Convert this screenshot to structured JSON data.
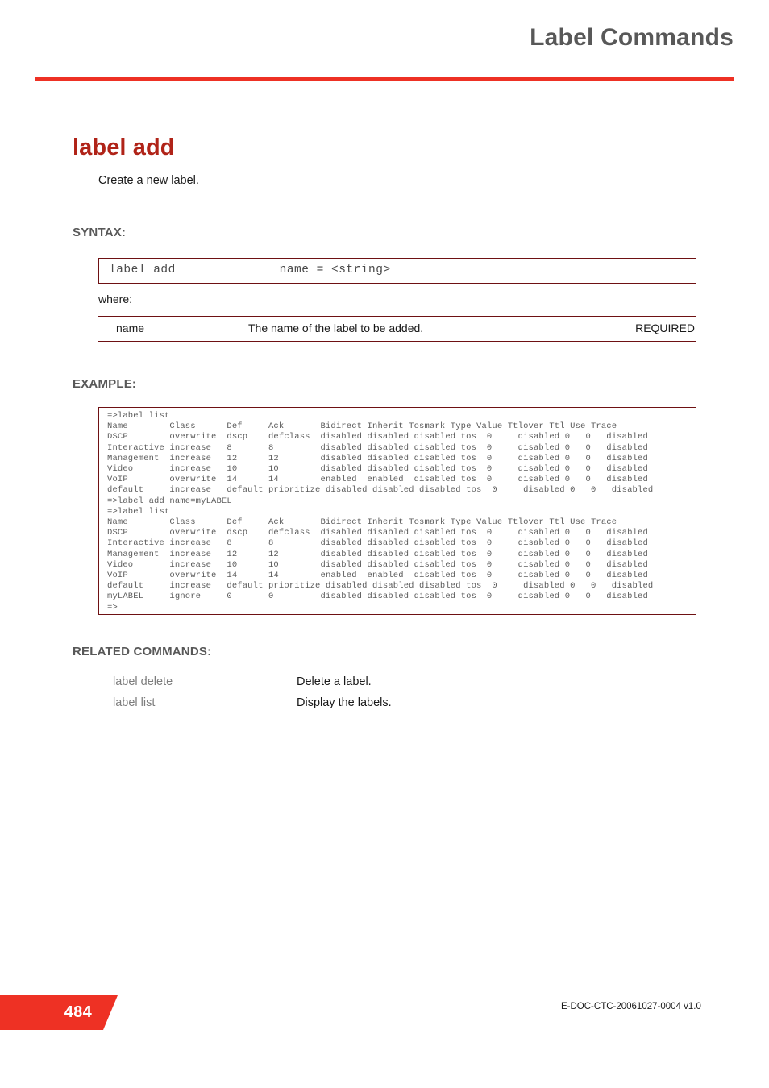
{
  "header": {
    "title": "Label Commands",
    "rule_color": "#ee3124"
  },
  "command": {
    "title": "label add",
    "description": "Create a new label."
  },
  "sections": {
    "syntax_label": "SYNTAX:",
    "example_label": "EXAMPLE:",
    "related_label": "RELATED COMMANDS:",
    "where_label": "where:"
  },
  "syntax": {
    "line": "label add              name = <string>"
  },
  "parameters": {
    "rows": [
      {
        "name": "name",
        "description": "The name of the label to be added.",
        "requirement": "REQUIRED"
      }
    ]
  },
  "example": {
    "console": "=>label list\nName        Class      Def     Ack       Bidirect Inherit Tosmark Type Value Ttlover Ttl Use Trace\nDSCP        overwrite  dscp    defclass  disabled disabled disabled tos  0     disabled 0   0   disabled\nInteractive increase   8       8         disabled disabled disabled tos  0     disabled 0   0   disabled\nManagement  increase   12      12        disabled disabled disabled tos  0     disabled 0   0   disabled\nVideo       increase   10      10        disabled disabled disabled tos  0     disabled 0   0   disabled\nVoIP        overwrite  14      14        enabled  enabled  disabled tos  0     disabled 0   0   disabled\ndefault     increase   default prioritize disabled disabled disabled tos  0     disabled 0   0   disabled\n=>label add name=myLABEL\n=>label list\nName        Class      Def     Ack       Bidirect Inherit Tosmark Type Value Ttlover Ttl Use Trace\nDSCP        overwrite  dscp    defclass  disabled disabled disabled tos  0     disabled 0   0   disabled\nInteractive increase   8       8         disabled disabled disabled tos  0     disabled 0   0   disabled\nManagement  increase   12      12        disabled disabled disabled tos  0     disabled 0   0   disabled\nVideo       increase   10      10        disabled disabled disabled tos  0     disabled 0   0   disabled\nVoIP        overwrite  14      14        enabled  enabled  disabled tos  0     disabled 0   0   disabled\ndefault     increase   default prioritize disabled disabled disabled tos  0     disabled 0   0   disabled\nmyLABEL     ignore     0       0         disabled disabled disabled tos  0     disabled 0   0   disabled\n=>"
  },
  "related_commands": {
    "rows": [
      {
        "name": "label delete",
        "description": "Delete a label."
      },
      {
        "name": "label list",
        "description": "Display the labels."
      }
    ]
  },
  "footer": {
    "page_number": "484",
    "doc_id": "E-DOC-CTC-20061027-0004 v1.0",
    "tab_color": "#ee3124"
  }
}
